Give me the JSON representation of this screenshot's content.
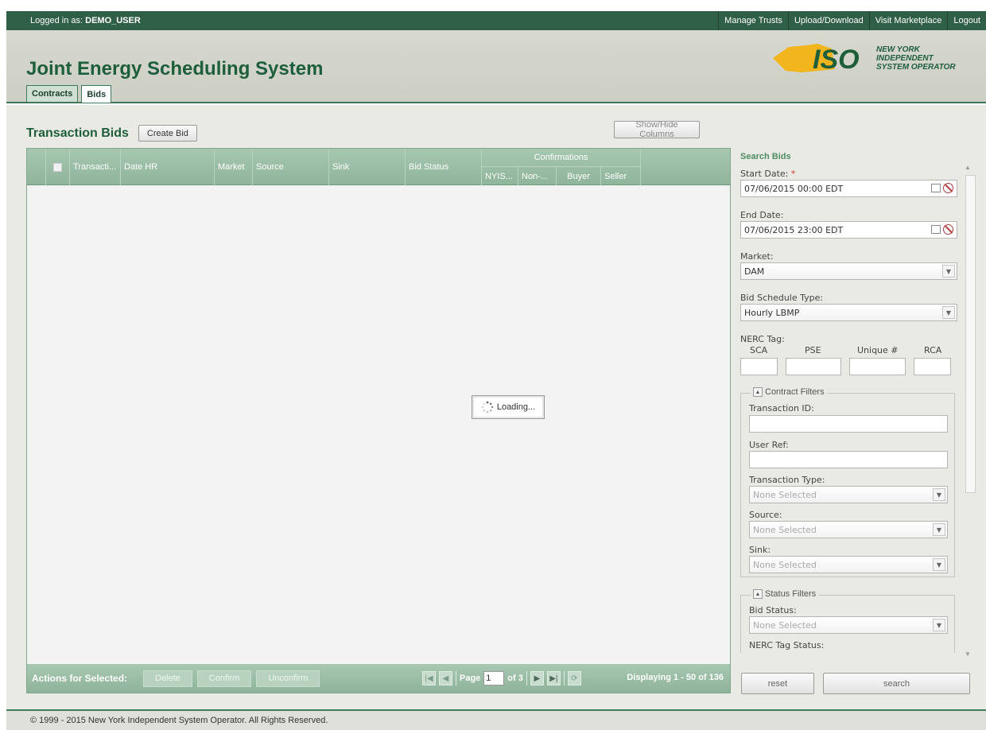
{
  "topbar": {
    "login_prefix": "Logged in as:",
    "username": "DEMO_USER",
    "links": [
      "Manage Trusts",
      "Upload/Download",
      "Visit Marketplace",
      "Logout"
    ]
  },
  "header": {
    "app_title": "Joint Energy Scheduling System",
    "tabs": [
      "Contracts",
      "Bids"
    ],
    "active_tab": "Bids",
    "logo": {
      "wordmark": "ISO",
      "lines": [
        "NEW YORK",
        "INDEPENDENT",
        "SYSTEM OPERATOR"
      ]
    }
  },
  "main": {
    "title": "Transaction Bids",
    "create_button": "Create Bid",
    "show_hide_button": "Show/Hide Columns",
    "grid": {
      "columns": [
        "Transacti...",
        "Date HR",
        "Market",
        "Source",
        "Sink",
        "Bid Status"
      ],
      "group_header": "Confirmations",
      "group_columns": [
        "NYIS...",
        "Non-...",
        "Buyer",
        "Seller"
      ],
      "loading_text": "Loading..."
    },
    "footer": {
      "actions_label": "Actions for Selected:",
      "delete": "Delete",
      "confirm": "Confirm",
      "unconfirm": "Unconfirm",
      "page_label": "Page",
      "page_value": "1",
      "of_label": "of 3",
      "displaying": "Displaying 1 - 50 of 136"
    }
  },
  "search": {
    "title": "Search Bids",
    "start_date_label": "Start Date:",
    "required_mark": "*",
    "start_date_value": "07/06/2015 00:00 EDT",
    "end_date_label": "End Date:",
    "end_date_value": "07/06/2015 23:00 EDT",
    "market_label": "Market:",
    "market_value": "DAM",
    "schedule_type_label": "Bid Schedule Type:",
    "schedule_type_value": "Hourly LBMP",
    "nerc_label": "NERC Tag:",
    "nerc_cols": [
      "SCA",
      "PSE",
      "Unique #",
      "RCA"
    ],
    "contract_filters": {
      "legend": "Contract Filters",
      "transaction_id_label": "Transaction ID:",
      "user_ref_label": "User Ref:",
      "transaction_type_label": "Transaction Type:",
      "transaction_type_value": "None Selected",
      "source_label": "Source:",
      "source_value": "None Selected",
      "sink_label": "Sink:",
      "sink_value": "None Selected"
    },
    "status_filters": {
      "legend": "Status Filters",
      "bid_status_label": "Bid Status:",
      "bid_status_value": "None Selected",
      "nerc_tag_status_label": "NERC Tag Status:"
    },
    "reset_button": "reset",
    "search_button": "search"
  },
  "footer": {
    "copyright": "© 1999 - 2015 New York Independent System Operator. All Rights Reserved."
  },
  "colors": {
    "topbar": "#2f5f47",
    "title_green": "#1d5e3b",
    "grid_header": "#8fb59b",
    "panel_title": "#4d8c65"
  }
}
